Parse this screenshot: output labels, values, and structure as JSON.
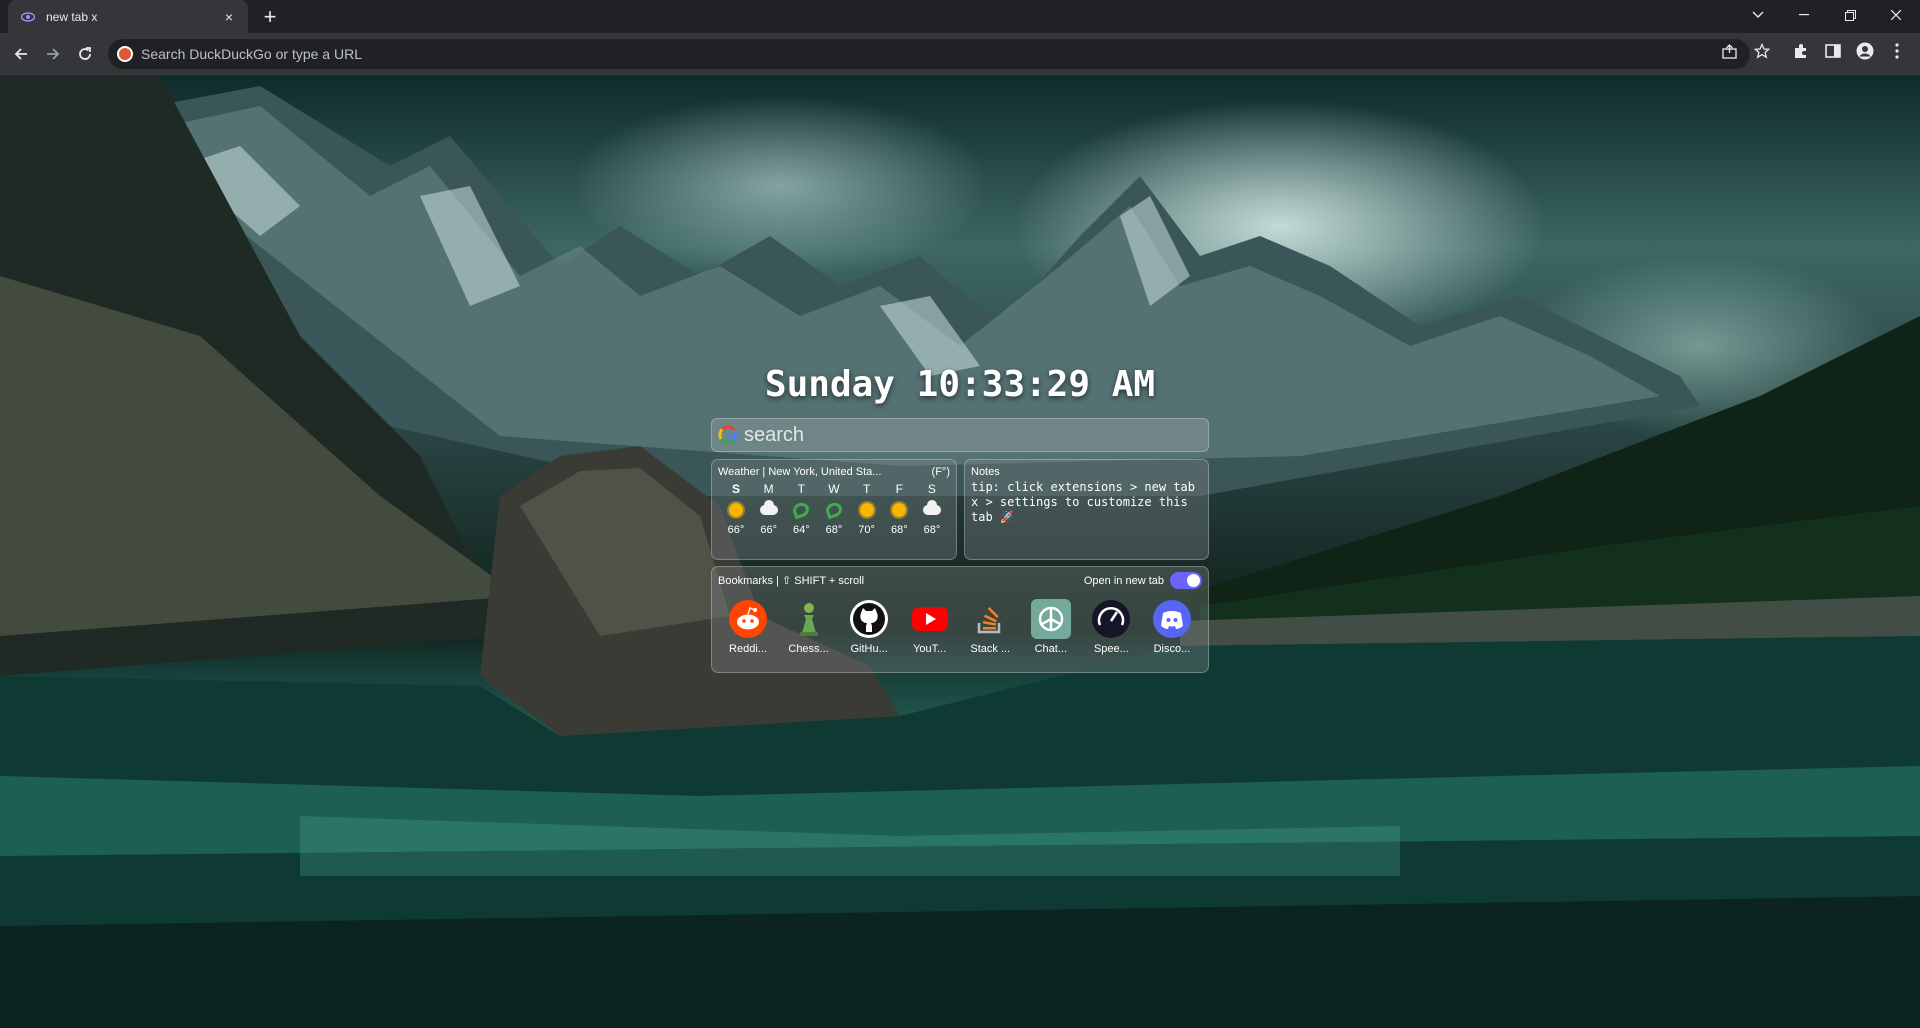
{
  "browser": {
    "tab_title": "new tab x",
    "tab_close_glyph": "×",
    "new_tab_glyph": "+",
    "address_placeholder": "Search DuckDuckGo or type a URL"
  },
  "clock": {
    "text": "Sunday 10:33:29 AM"
  },
  "search": {
    "placeholder": "search"
  },
  "weather": {
    "title": "Weather | New York, United Sta...",
    "unit": "(F°)",
    "days": [
      {
        "label": "S",
        "icon": "sun-icon",
        "temp": "66°"
      },
      {
        "label": "M",
        "icon": "cloud-icon",
        "temp": "66°"
      },
      {
        "label": "T",
        "icon": "wind-icon",
        "temp": "64°"
      },
      {
        "label": "W",
        "icon": "wind-icon",
        "temp": "68°"
      },
      {
        "label": "T",
        "icon": "sun-icon",
        "temp": "70°"
      },
      {
        "label": "F",
        "icon": "sun-icon",
        "temp": "68°"
      },
      {
        "label": "S",
        "icon": "cloud-icon",
        "temp": "68°"
      }
    ]
  },
  "notes": {
    "title": "Notes",
    "body": "tip: click extensions > new tab\nx > settings to customize this\ntab 🚀"
  },
  "bookmarks": {
    "title": "Bookmarks | ⇧ SHIFT + scroll",
    "toggle_label": "Open in new tab",
    "toggle_on": true,
    "items": [
      {
        "label": "Reddi...",
        "icon": "reddit-icon",
        "color": "#ff4500"
      },
      {
        "label": "Chess...",
        "icon": "chess-pawn-icon",
        "color": "#6aa84f"
      },
      {
        "label": "GitHu...",
        "icon": "github-icon",
        "color": "#ffffff"
      },
      {
        "label": "YouT...",
        "icon": "youtube-icon",
        "color": "#ff0000"
      },
      {
        "label": "Stack ...",
        "icon": "stackoverflow-icon",
        "color": "#f48024"
      },
      {
        "label": "Chat...",
        "icon": "chatgpt-icon",
        "color": "#74aa9c"
      },
      {
        "label": "Spee...",
        "icon": "speedtest-icon",
        "color": "#141526"
      },
      {
        "label": "Disco...",
        "icon": "discord-icon",
        "color": "#5865f2"
      }
    ]
  }
}
